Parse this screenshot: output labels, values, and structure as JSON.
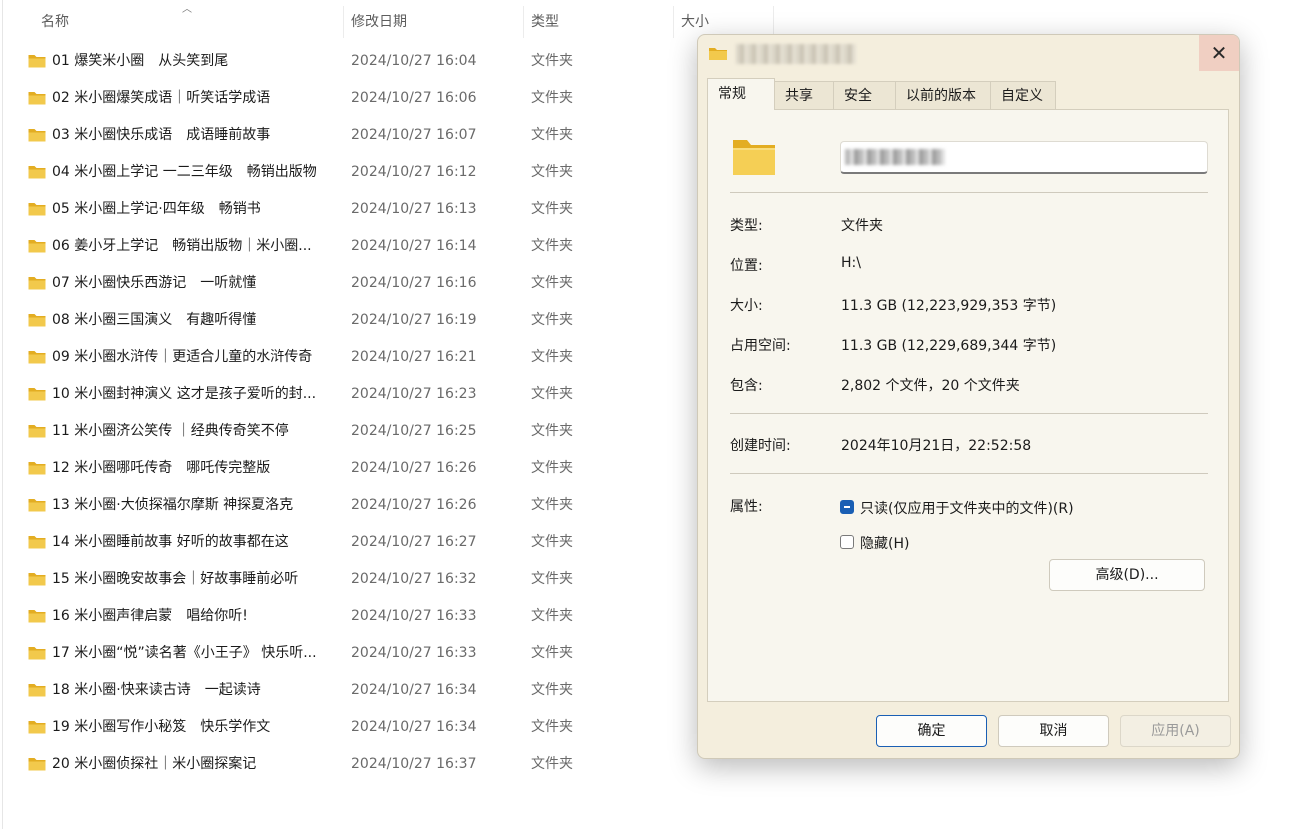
{
  "columns": {
    "name": "名称",
    "modified": "修改日期",
    "type": "类型",
    "size": "大小"
  },
  "files": [
    {
      "name": "01 爆笑米小圈　从头笑到尾",
      "date": "2024/10/27 16:04",
      "type": "文件夹"
    },
    {
      "name": "02 米小圈爆笑成语｜听笑话学成语",
      "date": "2024/10/27 16:06",
      "type": "文件夹"
    },
    {
      "name": "03 米小圈快乐成语　成语睡前故事",
      "date": "2024/10/27 16:07",
      "type": "文件夹"
    },
    {
      "name": "04 米小圈上学记 一二三年级　畅销出版物",
      "date": "2024/10/27 16:12",
      "type": "文件夹"
    },
    {
      "name": "05 米小圈上学记·四年级　畅销书",
      "date": "2024/10/27 16:13",
      "type": "文件夹"
    },
    {
      "name": "06 姜小牙上学记　畅销出版物｜米小圈...",
      "date": "2024/10/27 16:14",
      "type": "文件夹"
    },
    {
      "name": "07 米小圈快乐西游记　一听就懂",
      "date": "2024/10/27 16:16",
      "type": "文件夹"
    },
    {
      "name": "08 米小圈三国演义　有趣听得懂",
      "date": "2024/10/27 16:19",
      "type": "文件夹"
    },
    {
      "name": "09 米小圈水浒传｜更适合儿童的水浒传奇",
      "date": "2024/10/27 16:21",
      "type": "文件夹"
    },
    {
      "name": "10 米小圈封神演义 这才是孩子爱听的封...",
      "date": "2024/10/27 16:23",
      "type": "文件夹"
    },
    {
      "name": "11 米小圈济公笑传 ｜经典传奇笑不停",
      "date": "2024/10/27 16:25",
      "type": "文件夹"
    },
    {
      "name": "12 米小圈哪吒传奇　哪吒传完整版",
      "date": "2024/10/27 16:26",
      "type": "文件夹"
    },
    {
      "name": "13 米小圈·大侦探福尔摩斯 神探夏洛克",
      "date": "2024/10/27 16:26",
      "type": "文件夹"
    },
    {
      "name": "14 米小圈睡前故事 好听的故事都在这",
      "date": "2024/10/27 16:27",
      "type": "文件夹"
    },
    {
      "name": "15 米小圈晚安故事会｜好故事睡前必听",
      "date": "2024/10/27 16:32",
      "type": "文件夹"
    },
    {
      "name": "16 米小圈声律启蒙　唱给你听!",
      "date": "2024/10/27 16:33",
      "type": "文件夹"
    },
    {
      "name": "17 米小圈“悦”读名著《小王子》 快乐听...",
      "date": "2024/10/27 16:33",
      "type": "文件夹"
    },
    {
      "name": "18 米小圈·快来读古诗　一起读诗",
      "date": "2024/10/27 16:34",
      "type": "文件夹"
    },
    {
      "name": "19 米小圈写作小秘笈　快乐学作文",
      "date": "2024/10/27 16:34",
      "type": "文件夹"
    },
    {
      "name": "20 米小圈侦探社｜米小圈探案记",
      "date": "2024/10/27 16:37",
      "type": "文件夹"
    }
  ],
  "dialog": {
    "close_glyph": "✕",
    "tabs": [
      "常规",
      "共享",
      "安全",
      "以前的版本",
      "自定义"
    ],
    "active_tab": "常规",
    "props": {
      "type_label": "类型:",
      "type_value": "文件夹",
      "location_label": "位置:",
      "location_value": "H:\\",
      "size_label": "大小:",
      "size_value": "11.3 GB (12,223,929,353 字节)",
      "disk_label": "占用空间:",
      "disk_value": "11.3 GB (12,229,689,344 字节)",
      "contains_label": "包含:",
      "contains_value": "2,802 个文件，20 个文件夹",
      "created_label": "创建时间:",
      "created_value": "2024年10月21日，22:52:58",
      "attributes_label": "属性:"
    },
    "readonly_label": "只读(仅应用于文件夹中的文件)(R)",
    "readonly_state": "indeterminate",
    "hidden_label": "隐藏(H)",
    "hidden_state": "unchecked",
    "advanced_label": "高级(D)...",
    "ok_label": "确定",
    "cancel_label": "取消",
    "apply_label": "应用(A)"
  },
  "colors": {
    "folder": "#f2c94c",
    "folder_dark": "#e3ad22",
    "accent": "#1a5fb4",
    "dialog_bg": "#f4eedd",
    "close_bg": "#f0cfc2"
  }
}
